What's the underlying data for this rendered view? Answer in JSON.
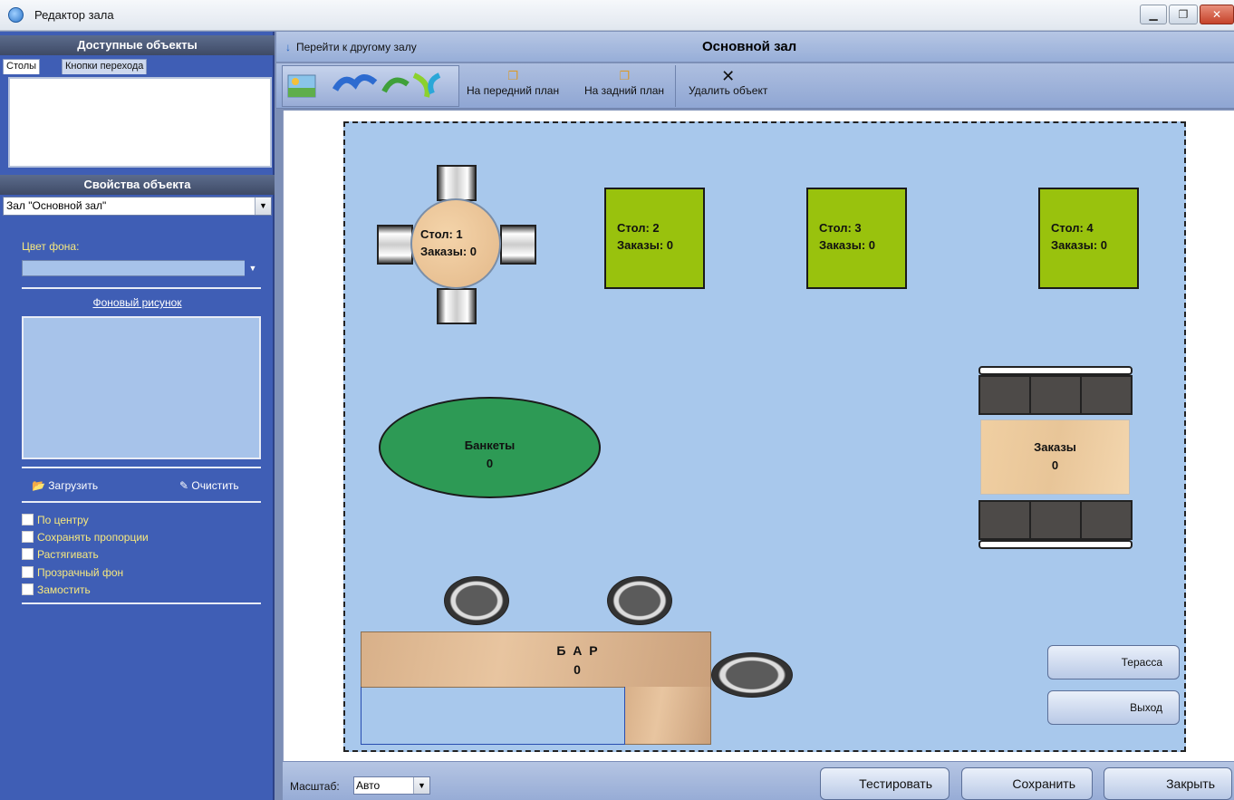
{
  "window": {
    "title": "Редактор зала",
    "controls": {
      "minimize": "▁",
      "maximize": "❐",
      "close": "✕"
    }
  },
  "left": {
    "available_objects_header": "Доступные объекты",
    "tabs": [
      {
        "label": "Столы",
        "active": true
      },
      {
        "label": "Кнопки перехода",
        "active": false
      }
    ],
    "properties_header": "Свойства объекта",
    "object_select": "Зал \"Основной зал\"",
    "bg_color_label": "Цвет фона:",
    "bg_picture_link": "Фоновый рисунок",
    "load_label": "Загрузить",
    "clear_label": "Очистить",
    "options": [
      "По центру",
      "Сохранять пропорции",
      "Растягивать",
      "Прозрачный фон",
      "Замостить"
    ]
  },
  "nav": {
    "goto_label": "Перейти к другому залу",
    "hall_title": "Основной зал"
  },
  "toolbar": {
    "to_front": "На передний план",
    "to_back": "На задний план",
    "delete": "Удалить объект"
  },
  "hall": {
    "table1": {
      "line1": "Стол: 1",
      "line2": "Заказы: 0"
    },
    "table2": {
      "line1": "Стол: 2",
      "line2": "Заказы: 0"
    },
    "table3": {
      "line1": "Стол: 3",
      "line2": "Заказы: 0"
    },
    "table4": {
      "line1": "Стол: 4",
      "line2": "Заказы: 0"
    },
    "banket": {
      "name": "Банкеты",
      "count": "0"
    },
    "orders": {
      "name": "Заказы",
      "count": "0"
    },
    "bar": {
      "name": "Б А Р",
      "count": "0"
    },
    "terrace_button": "Терасса",
    "exit_button": "Выход"
  },
  "status": {
    "scale_label": "Масштаб:",
    "scale_value": "Авто",
    "test_button": "Тестировать",
    "save_button": "Сохранить",
    "close_button": "Закрыть"
  },
  "colors": {
    "panel": "#3f5eb5",
    "hall_bg": "#a8c8ec",
    "square_table": "#99c20d",
    "banket": "#2d9a55"
  }
}
